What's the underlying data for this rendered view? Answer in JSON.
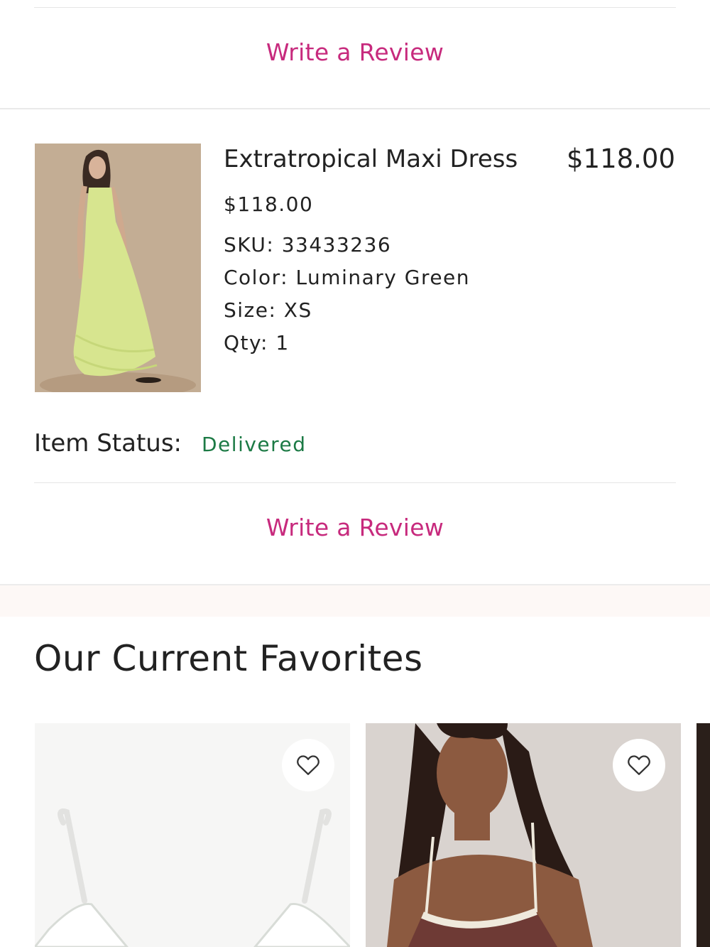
{
  "actions": {
    "write_review_label": "Write a Review"
  },
  "order_item": {
    "name": "Extratropical Maxi Dress",
    "total_price": "$118.00",
    "unit_price": "$118.00",
    "sku": "SKU: 33433236",
    "color": "Color: Luminary Green",
    "size": "Size: XS",
    "qty": "Qty: 1",
    "status_label": "Item Status:",
    "status_value": "Delivered"
  },
  "favorites": {
    "title": "Our Current Favorites",
    "products": [
      {
        "image_alt": "White lace bralette",
        "wishlist_icon": "heart-outline-icon"
      },
      {
        "image_alt": "Model in brown lace-trim cami",
        "wishlist_icon": "heart-outline-icon"
      }
    ]
  },
  "colors": {
    "link_pink": "#c72a7d",
    "status_green": "#1c7a45",
    "text_dark": "#222222"
  }
}
